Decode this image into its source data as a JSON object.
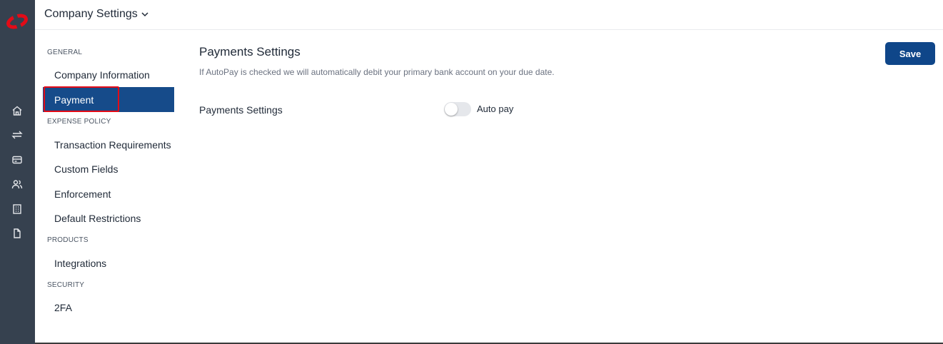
{
  "header": {
    "title": "Company Settings"
  },
  "sidebar": {
    "sections": [
      {
        "label": "GENERAL",
        "items": [
          {
            "label": "Company Information"
          },
          {
            "label": "Payment",
            "active": true
          }
        ]
      },
      {
        "label": "EXPENSE POLICY",
        "items": [
          {
            "label": "Transaction Requirements"
          },
          {
            "label": "Custom Fields"
          },
          {
            "label": "Enforcement"
          },
          {
            "label": "Default Restrictions"
          }
        ]
      },
      {
        "label": "PRODUCTS",
        "items": [
          {
            "label": "Integrations"
          }
        ]
      },
      {
        "label": "SECURITY",
        "items": [
          {
            "label": "2FA"
          }
        ]
      }
    ]
  },
  "rail": {
    "icons": [
      "home-icon",
      "transfer-icon",
      "card-icon",
      "users-icon",
      "building-icon",
      "document-icon"
    ]
  },
  "main": {
    "title": "Payments Settings",
    "description": "If AutoPay is checked we will automatically debit your primary bank account on your due date.",
    "save_label": "Save",
    "setting_row": {
      "label": "Payments Settings",
      "toggle_label": "Auto pay",
      "toggle_on": false
    }
  },
  "colors": {
    "accent": "#164b8a",
    "save": "#0f4689",
    "highlight": "#e30b17",
    "rail": "#36414f",
    "logo": "#e30b17"
  }
}
